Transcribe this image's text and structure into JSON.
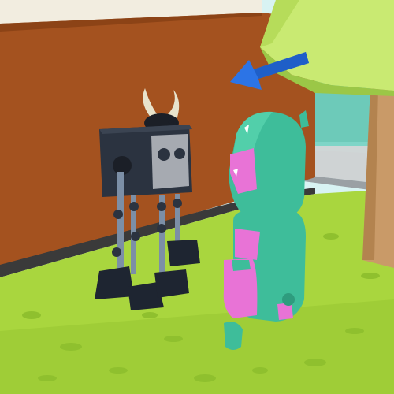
{
  "scene": {
    "kind": "3d-low-poly-game-view",
    "hud_text": "",
    "colors": {
      "wall": "#a4521f",
      "wall_top": "#f2ede0",
      "grass": "#a9d63e",
      "grass_dark": "#86b52a",
      "tree_leaves": "#c9ea72",
      "tree_trunk": "#c99a68",
      "player_teal": "#3ebd9a",
      "player_pink": "#e873d6",
      "npc_body": "#2b3340",
      "npc_face": "#a6aab1",
      "arrow": "#2c74e6",
      "horn": "#e8e3cc"
    },
    "icons": {
      "direction_arrow": "arrow-left-icon"
    }
  }
}
